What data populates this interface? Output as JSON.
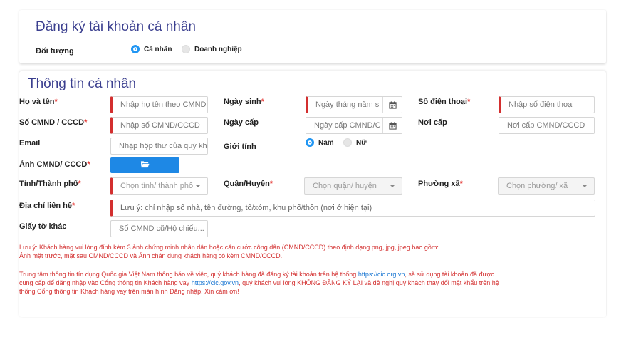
{
  "section1": {
    "title": "Đăng ký tài khoản cá nhân",
    "doi_tuong_label": "Đối tượng",
    "radio_ca_nhan": "Cá nhân",
    "radio_doanh_nghiep": "Doanh nghiệp",
    "selected": "Cá nhân"
  },
  "section2": {
    "title": "Thông tin cá nhân",
    "ho_ten": {
      "label": "Họ và tên",
      "placeholder": "Nhập họ tên theo CMND"
    },
    "ngay_sinh": {
      "label": "Ngày sinh",
      "placeholder": "Ngày tháng năm s"
    },
    "so_dien_thoai": {
      "label": "Số điện thoại",
      "placeholder": "Nhập số điện thoại"
    },
    "so_cmnd": {
      "label": "Số CMND / CCCD",
      "placeholder": "Nhập số CMND/CCCD"
    },
    "ngay_cap": {
      "label": "Ngày cấp",
      "placeholder": "Ngày cấp CMND/C"
    },
    "noi_cap": {
      "label": "Nơi cấp",
      "placeholder": "Nơi cấp CMND/CCCD"
    },
    "email": {
      "label": "Email",
      "placeholder": "Nhập hộp thư của quý kh"
    },
    "gioi_tinh": {
      "label": "Giới tính",
      "nam": "Nam",
      "nu": "Nữ",
      "selected": "Nam"
    },
    "anh_cmnd": {
      "label": "Ảnh CMND/ CCCD"
    },
    "tinh": {
      "label": "Tỉnh/Thành phố",
      "placeholder": "Chọn tỉnh/ thành phố"
    },
    "quan": {
      "label": "Quận/Huyện",
      "placeholder": "Chọn quận/ huyện"
    },
    "phuong": {
      "label": "Phường xã",
      "placeholder": "Chọn phường/ xã"
    },
    "dia_chi": {
      "label": "Địa chỉ liên hệ",
      "placeholder": "Lưu ý: chỉ nhập số nhà, tên đường, tổ/xóm, khu phố/thôn (nơi ở hiện tại)"
    },
    "giay_to": {
      "label": "Giấy tờ khác",
      "placeholder": "Số CMND cũ/Hộ chiếu..."
    },
    "required_mark": "*"
  },
  "notes": {
    "n1_a": "Lưu ý: Khách hàng vui lòng đính kèm 3 ảnh chứng minh nhân dân hoặc căn cước công dân (CMND/CCCD) theo định dạng png, jpg, jpeg bao gồm:",
    "n1_b": "Ảnh ",
    "n1_link1": "mặt trước",
    "n1_c": ", ",
    "n1_link2": "mặt sau",
    "n1_d": " CMND/CCCD và ",
    "n1_link3": "Ảnh chân dung khách hàng",
    "n1_e": " có kèm CMND/CCCD.",
    "n2_a": "Trung tâm thông tin tín dụng Quốc gia Việt Nam thông báo về việc, quý khách hàng đã đăng ký tài khoản trên hệ thống ",
    "n2_url1": "https://cic.org.vn",
    "n2_b": ", sẽ sử dụng tài khoản đã được",
    "n2_c": "cung cấp để đăng nhập vào Cổng thông tin Khách hàng vay ",
    "n2_url2": "https://cic.gov.vn",
    "n2_d": ", quý khách vui lòng ",
    "n2_u": "KHÔNG ĐĂNG KÝ LẠI",
    "n2_e": " và đề nghị quý khách thay đổi mật khẩu trên hệ",
    "n2_f": "thống Cổng thông tin Khách hàng vay trên màn hình Đăng nhập. Xin cảm ơn!"
  },
  "colors": {
    "accent": "#2196f3",
    "required": "#d32f2f",
    "title": "#3b3f8f"
  },
  "icons": {
    "calendar": "calendar-icon",
    "folder": "folder-open-icon",
    "dropdown": "chevron-down-icon"
  }
}
